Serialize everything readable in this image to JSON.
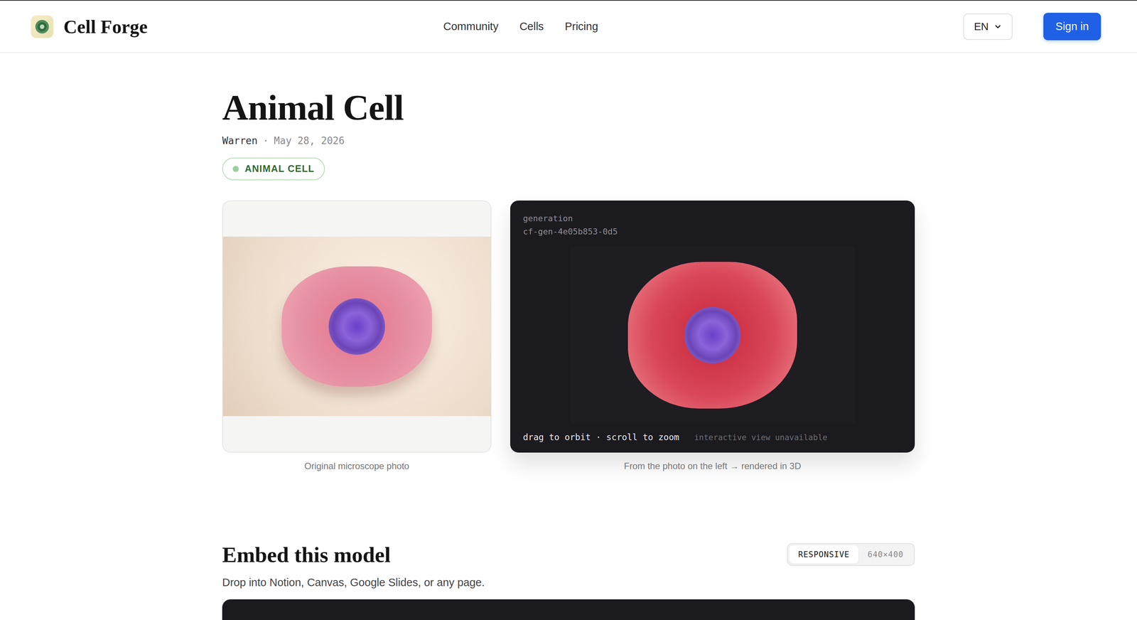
{
  "brand": {
    "name": "Cell Forge"
  },
  "nav": [
    {
      "label": "Community",
      "selected": false
    },
    {
      "label": "Cells",
      "selected": false
    },
    {
      "label": "Pricing",
      "selected": false
    }
  ],
  "language": {
    "value": "EN",
    "expanded": false
  },
  "sign_in": "Sign in",
  "article": {
    "title": "Animal Cell",
    "author": "Warren",
    "separator": "·",
    "date": "May 28, 2026",
    "tag": {
      "label": "ANIMAL CELL",
      "color": "#9fcc9f"
    }
  },
  "photo": {
    "caption": "Original microscope photo"
  },
  "viewer": {
    "label": "generation",
    "id": "cf-gen-4e05b853-0d5",
    "hint": "drag to orbit · scroll to zoom",
    "notice": "interactive view unavailable",
    "caption": "From the photo on the left → rendered in 3D"
  },
  "embed": {
    "title": "Embed this model",
    "description": "Drop into Notion, Canvas, Google Slides, or any page.",
    "sizes": [
      {
        "label": "RESPONSIVE",
        "selected": true
      },
      {
        "label": "640×400",
        "selected": false
      }
    ]
  }
}
